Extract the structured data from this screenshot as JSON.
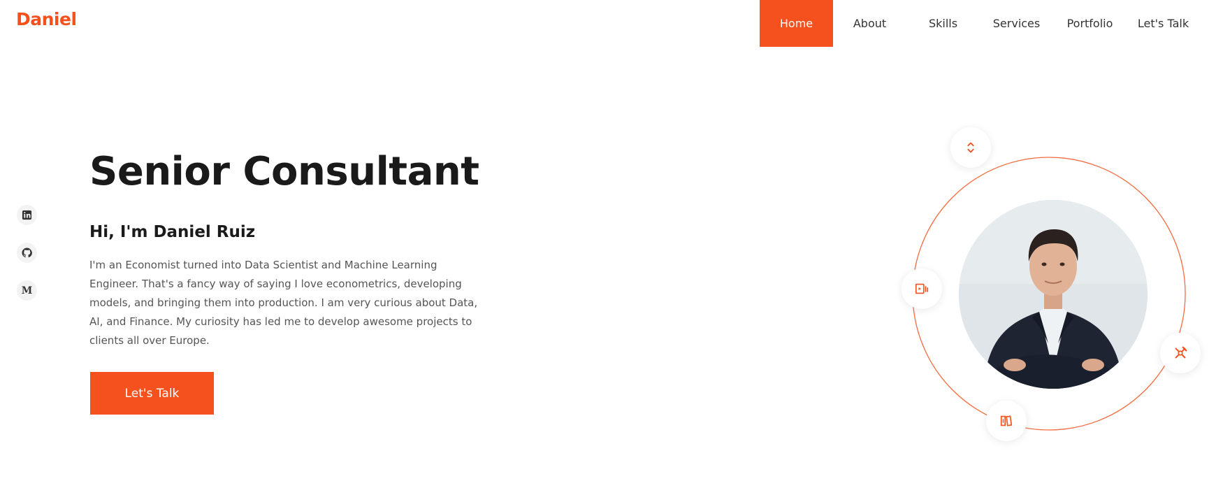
{
  "brand": {
    "logo": "Daniel",
    "accent_color": "#f4511e"
  },
  "nav": {
    "items": [
      {
        "label": "Home",
        "active": true
      },
      {
        "label": "About",
        "active": false
      },
      {
        "label": "Skills",
        "active": false
      },
      {
        "label": "Services",
        "active": false
      },
      {
        "label": "Portfolio",
        "active": false
      },
      {
        "label": "Let's Talk",
        "active": false
      }
    ]
  },
  "social": [
    {
      "icon": "linkedin-icon"
    },
    {
      "icon": "github-icon"
    },
    {
      "icon": "medium-icon",
      "glyph": "M"
    }
  ],
  "hero": {
    "title": "Senior Consultant",
    "subtitle": "Hi, I'm Daniel Ruiz",
    "description": "I'm an Economist turned into Data Scientist and Machine Learning Engineer. That's a fancy way of saying I love econometrics, developing models, and bringing them into production. I am very curious about Data, AI, and Finance. My curiosity has led me to develop awesome projects to clients all over Europe.",
    "cta_label": "Let's Talk"
  },
  "orbit": {
    "icons": [
      "arrows-icon",
      "presentation-icon",
      "tools-icon",
      "books-icon"
    ]
  }
}
